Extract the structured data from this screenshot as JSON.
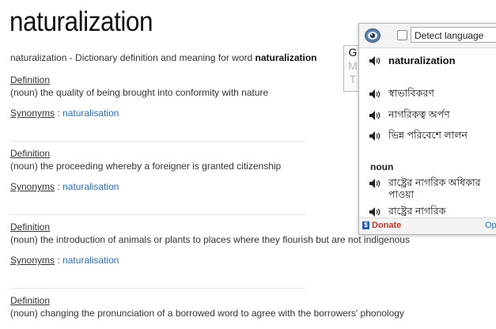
{
  "page": {
    "title": "naturalization",
    "intro_prefix": "naturalization - Dictionary definition and meaning for word ",
    "intro_word": "naturalization"
  },
  "definitions": [
    {
      "label": "Definition",
      "text": "(noun) the quality of being brought into conformity with nature",
      "synonyms_label": "Synonyms",
      "separator": " : ",
      "synonym": "naturalisation"
    },
    {
      "label": "Definition",
      "text": "(noun) the proceeding whereby a foreigner is granted citizenship",
      "synonyms_label": "Synonyms",
      "separator": " : ",
      "synonym": "naturalisation"
    },
    {
      "label": "Definition",
      "text": "(noun) the introduction of animals or plants to places where they flourish but are not indigenous",
      "synonyms_label": "Synonyms",
      "separator": " : ",
      "synonym": "naturalisation"
    },
    {
      "label": "Definition",
      "text": "(noun) changing the pronunciation of a borrowed word to agree with the borrowers' phonology"
    }
  ],
  "translator": {
    "detect_label": "Detect language",
    "source_word": "naturalization",
    "translations": [
      "স্বাভাবিকরণ",
      "নাগরিকত্ব অর্পণ",
      "ভিন্ন পরিবেশে লালন"
    ],
    "pos_label": "noun",
    "noun_translations": [
      "রাষ্ট্রের নাগরিক অধিকার পাওয়া",
      "রাষ্ট্রের নাগরিক"
    ],
    "donate_label": "Donate",
    "options_label": "Op",
    "gmt_letters": [
      "G",
      "M",
      "T"
    ]
  },
  "colors": {
    "link": "#2a6fb5",
    "donate": "#c0392b"
  }
}
